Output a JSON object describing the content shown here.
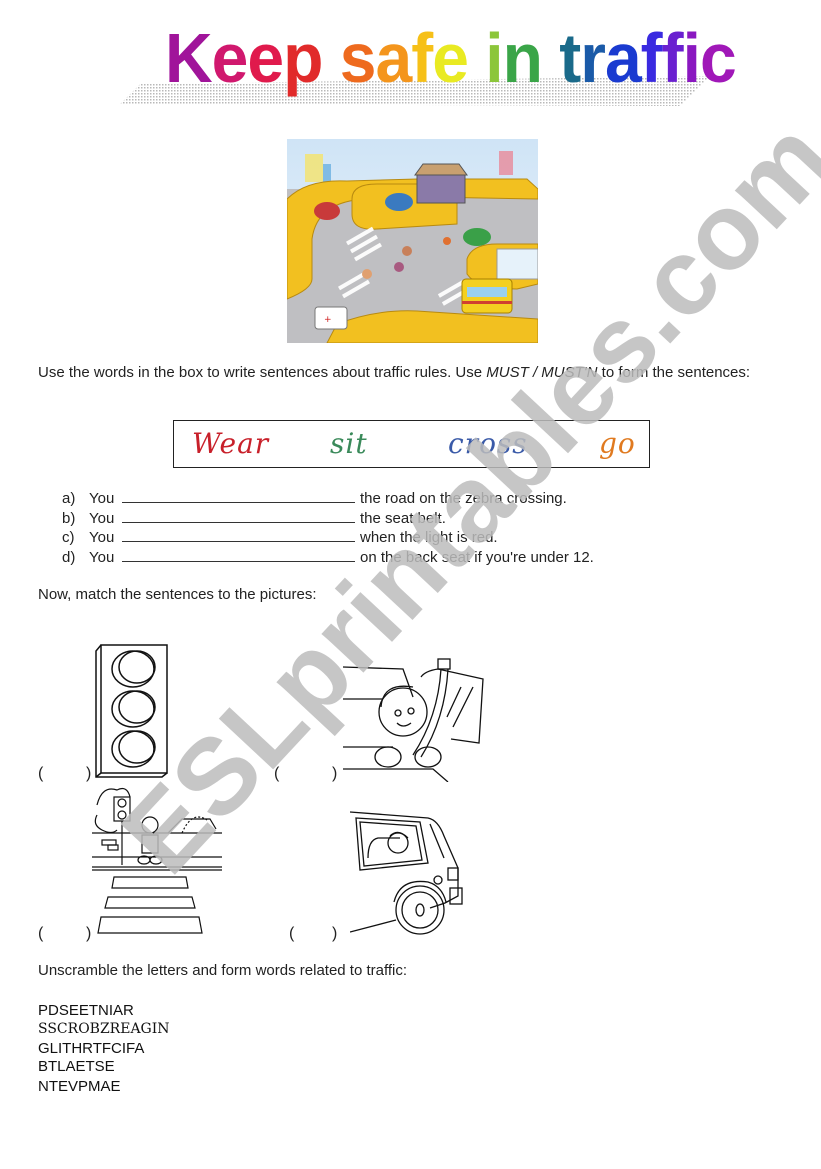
{
  "title": {
    "text": "Keep safe in traffic",
    "letters": [
      {
        "ch": "K",
        "color": "#a0149a"
      },
      {
        "ch": "e",
        "color": "#d0186e"
      },
      {
        "ch": "e",
        "color": "#e01a4c"
      },
      {
        "ch": "p",
        "color": "#e12a2a"
      },
      {
        "ch": " ",
        "color": "#ffffff"
      },
      {
        "ch": "s",
        "color": "#ee6a1e"
      },
      {
        "ch": "a",
        "color": "#f4951c"
      },
      {
        "ch": "f",
        "color": "#f6c018"
      },
      {
        "ch": "e",
        "color": "#e9ea22"
      },
      {
        "ch": " ",
        "color": "#ffffff"
      },
      {
        "ch": "i",
        "color": "#8cc63a"
      },
      {
        "ch": "n",
        "color": "#3aa548"
      },
      {
        "ch": " ",
        "color": "#ffffff"
      },
      {
        "ch": "t",
        "color": "#1a6a8a"
      },
      {
        "ch": "r",
        "color": "#1a5aa8"
      },
      {
        "ch": "a",
        "color": "#1a3ad0"
      },
      {
        "ch": "f",
        "color": "#3a2ae0"
      },
      {
        "ch": "f",
        "color": "#6a20d0"
      },
      {
        "ch": "i",
        "color": "#8a18c0"
      },
      {
        "ch": "c",
        "color": "#a018b8"
      }
    ]
  },
  "scene_picture": {
    "description": "Cartoon city intersection with zebra crossings, pedestrians, cars, a bus and an ambulance"
  },
  "exercise1": {
    "instruction_pre": "Use the words in the box to write sentences about traffic rules. Use ",
    "instruction_modal": "MUST / MUST'N",
    "instruction_post": " to form the sentences:",
    "words": [
      {
        "text": "Wear",
        "color": "#c8202a"
      },
      {
        "text": "sit",
        "color": "#3a8a5a"
      },
      {
        "text": "cross",
        "color": "#3a5aa8"
      },
      {
        "text": "go",
        "color": "#e07a20"
      }
    ],
    "sentences": [
      {
        "letter": "a)",
        "subject": "You",
        "rest": "the road on the zebra crossing."
      },
      {
        "letter": "b)",
        "subject": "You",
        "rest": "the seat belt."
      },
      {
        "letter": "c)",
        "subject": "You",
        "rest": "when the light is red."
      },
      {
        "letter": "d)",
        "subject": "You",
        "rest": "on the back seat if you're under 12."
      }
    ]
  },
  "exercise2": {
    "instruction": "Now, match the sentences to the pictures:",
    "pictures": [
      {
        "name": "traffic-light",
        "answer_open": "(",
        "answer_close": ")"
      },
      {
        "name": "child-with-seat-belt",
        "answer_open": "(",
        "answer_close": ")"
      },
      {
        "name": "boy-at-zebra-crossing",
        "answer_open": "(",
        "answer_close": ")"
      },
      {
        "name": "child-in-back-seat",
        "answer_open": "(",
        "answer_close": ")"
      }
    ]
  },
  "exercise3": {
    "instruction": "Unscramble the letters and form words related to traffic:",
    "words": [
      "PDSEETNIAR",
      "SSCROBZREAGIN",
      "GLITHRTFCIFA",
      "BTLAETSE",
      "NTEVPMAE"
    ]
  },
  "watermark": {
    "text": "ESLprintables.com",
    "color": "#bdbdbd"
  }
}
